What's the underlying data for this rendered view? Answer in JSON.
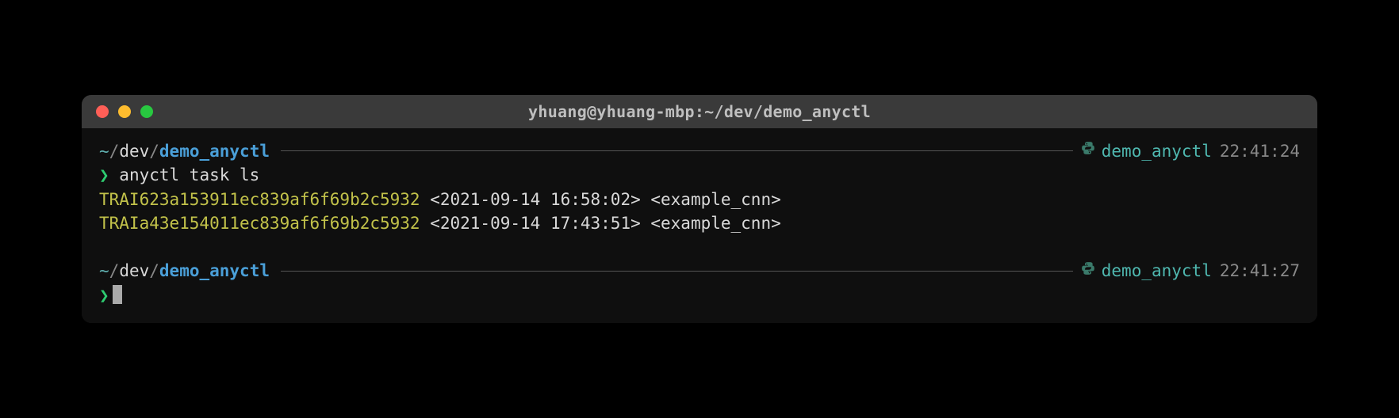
{
  "window": {
    "title": "yhuang@yhuang-mbp:~/dev/demo_anyctl"
  },
  "prompt1": {
    "tilde": "~",
    "sep1": "/",
    "parent": "dev",
    "sep2": "/",
    "dir": "demo_anyctl",
    "env": "demo_anyctl",
    "time": "22:41:24"
  },
  "command1": {
    "symbol": "❯",
    "text": " anyctl task ls"
  },
  "output": {
    "rows": [
      {
        "id": "TRAI623a153911ec839af6f69b2c5932",
        "meta": " <2021-09-14 16:58:02> <example_cnn>"
      },
      {
        "id": "TRAIa43e154011ec839af6f69b2c5932",
        "meta": " <2021-09-14 17:43:51> <example_cnn>"
      }
    ]
  },
  "prompt2": {
    "tilde": "~",
    "sep1": "/",
    "parent": "dev",
    "sep2": "/",
    "dir": "demo_anyctl",
    "env": "demo_anyctl",
    "time": "22:41:27"
  },
  "command2": {
    "symbol": "❯"
  }
}
